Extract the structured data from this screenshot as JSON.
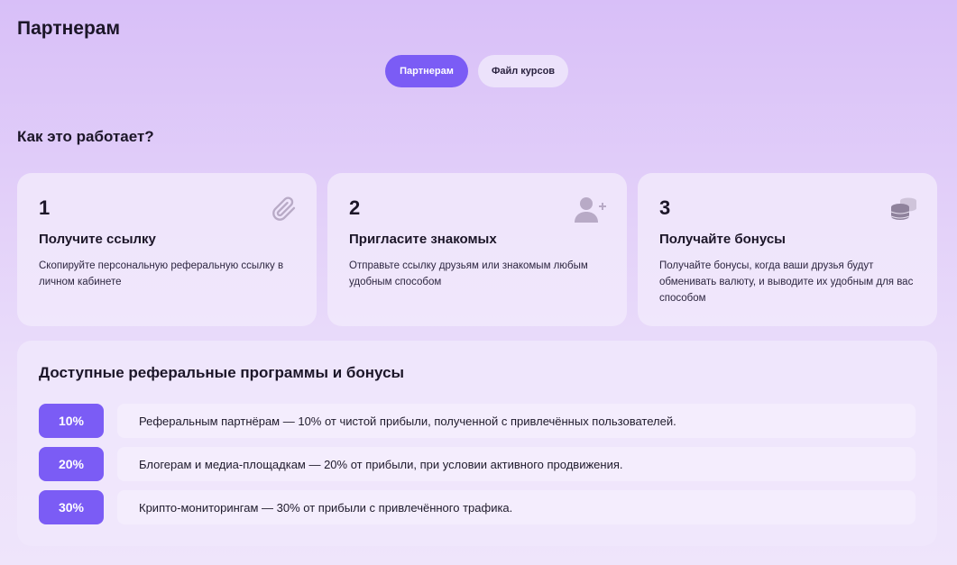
{
  "page": {
    "title": "Партнерам"
  },
  "tabs": [
    {
      "label": "Партнерам",
      "active": true
    },
    {
      "label": "Файл курсов",
      "active": false
    }
  ],
  "how_it_works": {
    "title": "Как это работает?",
    "steps": [
      {
        "number": "1",
        "title": "Получите ссылку",
        "description": "Скопируйте персональную реферальную ссылку в личном кабинете",
        "icon": "paperclip-icon"
      },
      {
        "number": "2",
        "title": "Пригласите знакомых",
        "description": "Отправьте ссылку друзьям или знакомым любым удобным способом",
        "icon": "add-user-icon"
      },
      {
        "number": "3",
        "title": "Получайте бонусы",
        "description": "Получайте бонусы, когда ваши друзья будут обменивать валюту, и выводите их удобным для вас способом",
        "icon": "coins-icon"
      }
    ]
  },
  "programs": {
    "title": "Доступные реферальные программы и бонусы",
    "items": [
      {
        "percent": "10%",
        "text": "Реферальным партнёрам — 10% от чистой прибыли, полученной с привлечённых пользователей."
      },
      {
        "percent": "20%",
        "text": "Блогерам и медиа-площадкам — 20% от прибыли, при условии активного продвижения."
      },
      {
        "percent": "30%",
        "text": "Крипто-мониторингам — 30% от прибыли с привлечённого трафика."
      }
    ]
  },
  "colors": {
    "accent": "#7b5cf5",
    "icon_gray": "#b8aac6"
  }
}
